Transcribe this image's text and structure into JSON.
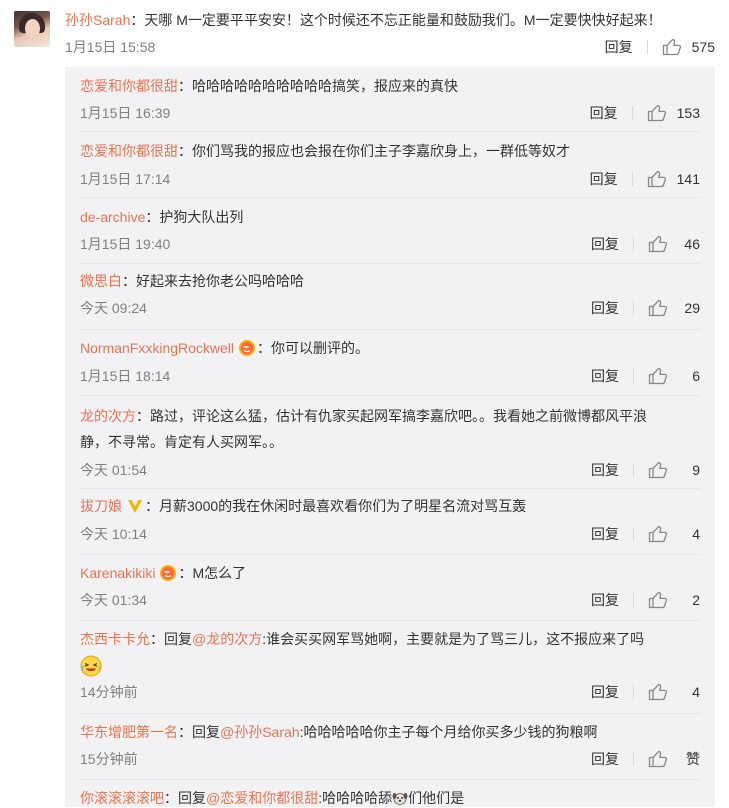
{
  "top": {
    "username": "孙孙Sarah",
    "text": "：天哪 M一定要平平安安！这个时候还不忘正能量和鼓励我们。M一定要快快好起来！",
    "time": "1月15日 15:58",
    "reply_label": "回复",
    "likes": "575"
  },
  "replies": [
    {
      "username": "恋爱和你都很甜",
      "text": "：哈哈哈哈哈哈哈哈哈哈搞笑，报应来的真快",
      "time": "1月15日 16:39",
      "reply_label": "回复",
      "likes": "153"
    },
    {
      "username": "恋爱和你都很甜",
      "text": "：你们骂我的报应也会报在你们主子李嘉欣身上，一群低等奴才",
      "time": "1月15日 17:14",
      "reply_label": "回复",
      "likes": "141"
    },
    {
      "username": "de-archive",
      "text": "：护狗大队出列",
      "time": "1月15日 19:40",
      "reply_label": "回复",
      "likes": "46"
    },
    {
      "username": "微思白",
      "text": "：好起来去抢你老公吗哈哈哈",
      "time": "今天 09:24",
      "reply_label": "回复",
      "likes": "29"
    },
    {
      "username": "NormanFxxkingRockwell",
      "badge": "fan-badge-icon",
      "text": "：你可以删评的。",
      "time": "1月15日 18:14",
      "reply_label": "回复",
      "likes": "6"
    },
    {
      "username": "龙的次方",
      "text": "：路过，评论这么猛，估计有仇家买起网军搞李嘉欣吧。。我看她之前微博都风平浪",
      "text2": "静，不寻常。肯定有人买网军。。",
      "time": "今天 01:54",
      "reply_label": "回复",
      "likes": "9"
    },
    {
      "username": "拔刀娘",
      "badge": "vip-v-icon",
      "text": "：月薪3000的我在休闲时最喜欢看你们为了明星名流对骂互轰",
      "time": "今天 10:14",
      "reply_label": "回复",
      "likes": "4"
    },
    {
      "username": "Karenakikiki",
      "badge": "fan-badge-icon",
      "text": "：M怎么了",
      "time": "今天 01:34",
      "reply_label": "回复",
      "likes": "2"
    },
    {
      "username": "杰西卡卡允",
      "prefix": "：回复",
      "mention": "@龙的次方",
      "text": ":谁会买买网军骂她啊，主要就是为了骂三儿，这不报应来了吗",
      "emoji": "laughing-emoji-icon",
      "time": "14分钟前",
      "reply_label": "回复",
      "likes": "4"
    },
    {
      "username": "华东增肥第一名",
      "prefix": "：回复",
      "mention": "@孙孙Sarah",
      "text": ":哈哈哈哈哈你主子每个月给你买多少钱的狗粮啊",
      "time": "15分钟前",
      "reply_label": "回复",
      "likes": "赞"
    },
    {
      "username": "你滚滚滚滚吧",
      "prefix": "：回复",
      "mention": "@恋爱和你都很甜",
      "text": ":哈哈哈哈舔",
      "text_after": "们他们是",
      "emoji": "dog-emoji-icon"
    }
  ]
}
